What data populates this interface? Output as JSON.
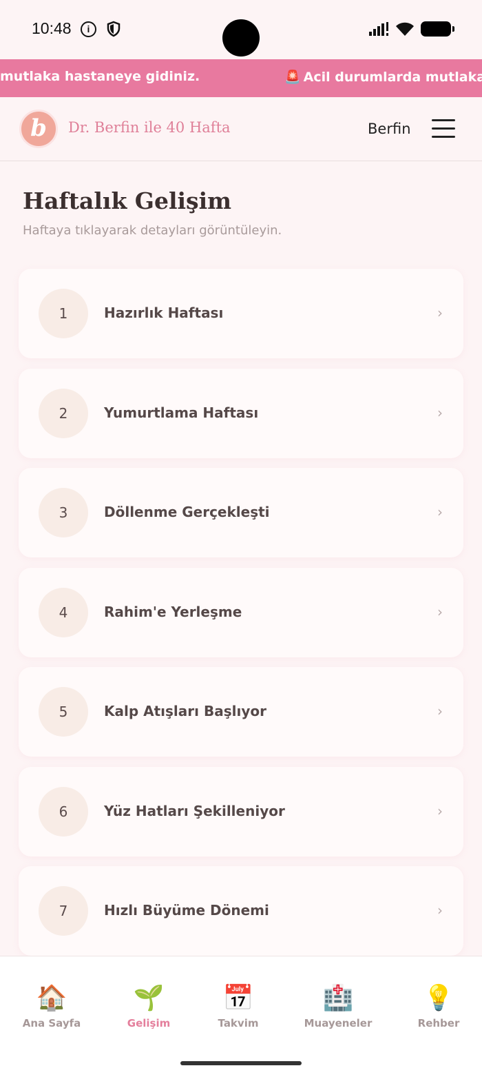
{
  "status": {
    "time": "10:48"
  },
  "ticker": {
    "segment_a": "mutlaka hastaneye gidiniz.",
    "segment_b_icon": "🚨",
    "segment_b": "Acil durumlarda mutlaka"
  },
  "header": {
    "logo_letter": "b",
    "brand": "Dr. Berfin ile 40 Hafta",
    "user": "Berfin"
  },
  "page": {
    "title": "Haftalık Gelişim",
    "subtitle": "Haftaya tıklayarak detayları görüntüleyin."
  },
  "weeks": [
    {
      "num": "1",
      "title": "Hazırlık Haftası"
    },
    {
      "num": "2",
      "title": "Yumurtlama Haftası"
    },
    {
      "num": "3",
      "title": "Döllenme Gerçekleşti"
    },
    {
      "num": "4",
      "title": "Rahim'e Yerleşme"
    },
    {
      "num": "5",
      "title": "Kalp Atışları Başlıyor"
    },
    {
      "num": "6",
      "title": "Yüz Hatları Şekilleniyor"
    },
    {
      "num": "7",
      "title": "Hızlı Büyüme Dönemi"
    }
  ],
  "chevron": "›",
  "nav": [
    {
      "icon": "🏠",
      "label": "Ana Sayfa"
    },
    {
      "icon": "🌱",
      "label": "Gelişim"
    },
    {
      "icon": "📅",
      "label": "Takvim"
    },
    {
      "icon": "🏥",
      "label": "Muayeneler"
    },
    {
      "icon": "💡",
      "label": "Rehber"
    }
  ],
  "colors": {
    "accent": "#e8799f",
    "brand": "#df7f98",
    "active_nav": "#e47f9c"
  }
}
